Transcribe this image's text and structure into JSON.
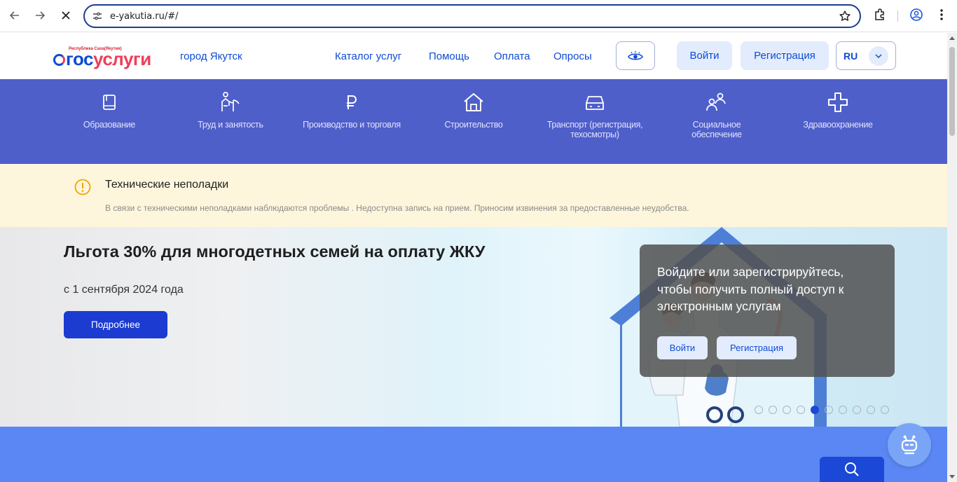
{
  "browser": {
    "url": "e-yakutia.ru/#/"
  },
  "header": {
    "logo_region": "Республика Саха(Якутия)",
    "logo_gos": "гос",
    "logo_uslugi": "услуги",
    "city": "город Якутск",
    "nav": [
      "Каталог услуг",
      "Помощь",
      "Оплата",
      "Опросы"
    ],
    "login": "Войти",
    "register": "Регистрация",
    "lang": "RU"
  },
  "categories": [
    {
      "label": "Образование",
      "icon": "book-icon"
    },
    {
      "label": "Труд и занятость",
      "icon": "worker-icon"
    },
    {
      "label": "Производство и торговля",
      "icon": "ruble-icon"
    },
    {
      "label": "Строительство",
      "icon": "house-icon"
    },
    {
      "label": "Транспорт (регистрация, техосмотры)",
      "icon": "car-icon"
    },
    {
      "label": "Социальное обеспечение",
      "icon": "people-icon"
    },
    {
      "label": "Здравоохранение",
      "icon": "medical-cross-icon"
    }
  ],
  "notice": {
    "title": "Технические неполадки",
    "text": "В связи с техническими неполадками наблюдаются проблемы . Недоступна запись на прием. Приносим извинения за предоставленные неудобства."
  },
  "banner": {
    "title": "Льгота 30% для многодетных семей на оплату ЖКУ",
    "subtitle": "с 1 сентября 2024 года",
    "button": "Подробнее",
    "slides_total": 10,
    "active_slide": 5
  },
  "login_card": {
    "text": "Войдите или зарегистрируйтесь, чтобы получить полный доступ к электронным услугам",
    "login": "Войти",
    "register": "Регистрация"
  },
  "colors": {
    "brand_blue": "#0d4cd3",
    "category_band": "#4f5fc9",
    "notice_bg": "#fdf6dc",
    "primary_button": "#1b3bd1",
    "bottom_band": "#5b87f5"
  }
}
